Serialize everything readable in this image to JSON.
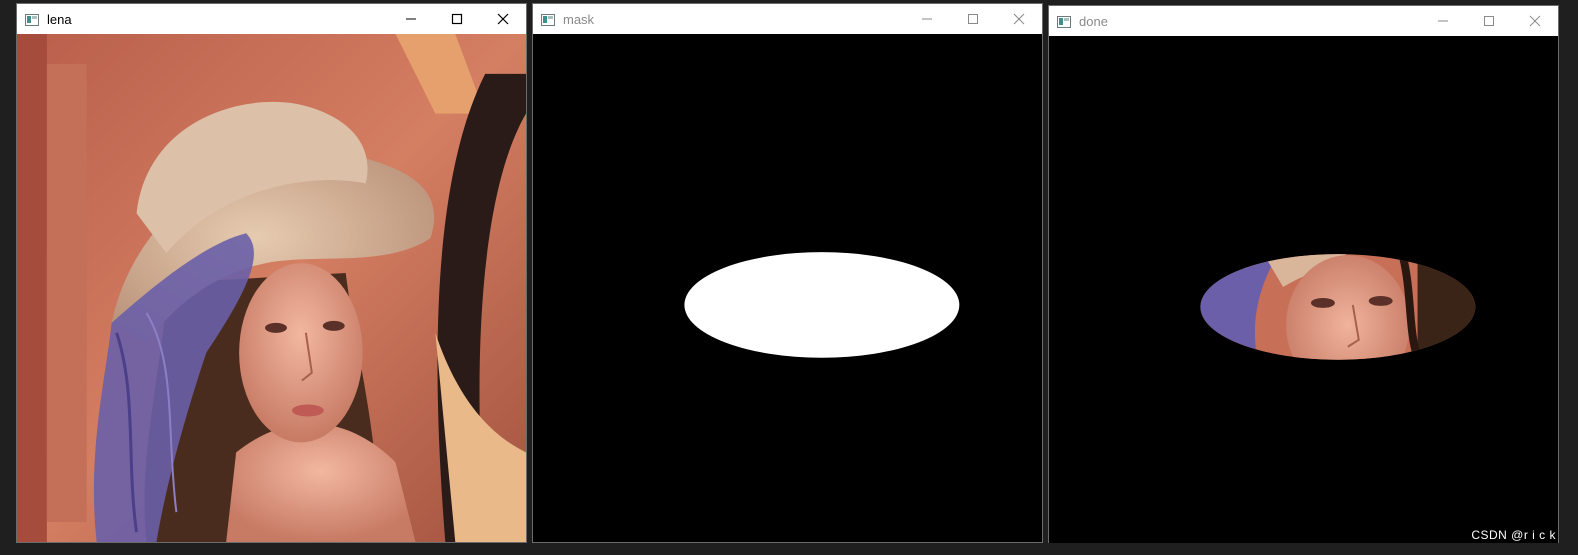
{
  "windows": [
    {
      "id": "lena",
      "title": "lena",
      "active": true
    },
    {
      "id": "mask",
      "title": "mask",
      "active": false
    },
    {
      "id": "done",
      "title": "done",
      "active": false
    }
  ],
  "watermark": "CSDN @r i c k",
  "colors": {
    "titlebar_bg": "#ffffff",
    "content_bg": "#000000",
    "mask_fill": "#ffffff",
    "skin": "#e8a08a",
    "background_warm": "#c8705a",
    "hat": "#d9b59a",
    "feather": "#6a5fa8",
    "hair": "#3a2418"
  },
  "icons": {
    "app": "opencv-window-icon",
    "minimize": "minimize-icon",
    "maximize": "maximize-icon",
    "close": "close-icon"
  }
}
